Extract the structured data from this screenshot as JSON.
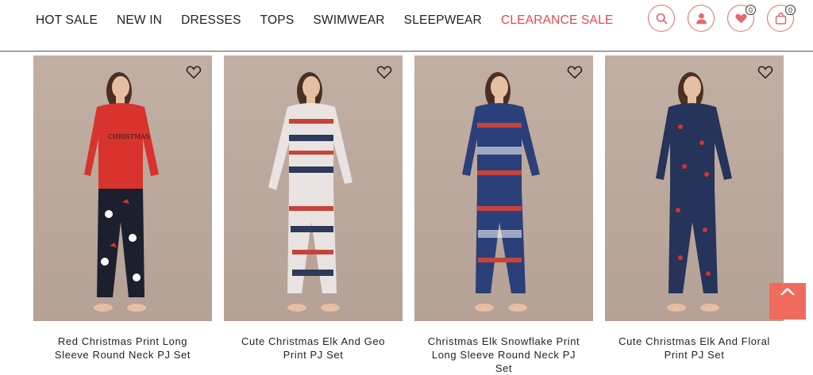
{
  "nav": {
    "items": [
      {
        "label": "HOT SALE"
      },
      {
        "label": "NEW IN"
      },
      {
        "label": "DRESSES"
      },
      {
        "label": "TOPS"
      },
      {
        "label": "SWIMWEAR"
      },
      {
        "label": "SLEEPWEAR"
      },
      {
        "label": "CLEARANCE SALE"
      }
    ]
  },
  "header_icons": {
    "search": "search-icon",
    "account": "user-icon",
    "wishlist": "heart-icon",
    "wishlist_count": "0",
    "cart": "bag-icon",
    "cart_count": "0"
  },
  "products": [
    {
      "name": "Red Christmas Print Long Sleeve Round Neck PJ Set",
      "top_color": "#d8332c",
      "bottom_color": "#1c1f2e"
    },
    {
      "name": "Cute Christmas Elk And Geo Print PJ Set",
      "top_color": "#e9e4e2",
      "bottom_color": "#e9e4e2"
    },
    {
      "name": "Christmas Elk Snowflake Print Long Sleeve Round Neck PJ Set",
      "top_color": "#2b3f7a",
      "bottom_color": "#2b3f7a"
    },
    {
      "name": "Cute Christmas Elk And Floral Print PJ Set",
      "top_color": "#26335a",
      "bottom_color": "#26335a"
    }
  ],
  "back_to_top": "^",
  "colors": {
    "accent": "#e8474d",
    "back_to_top_bg": "#f06a5e"
  }
}
